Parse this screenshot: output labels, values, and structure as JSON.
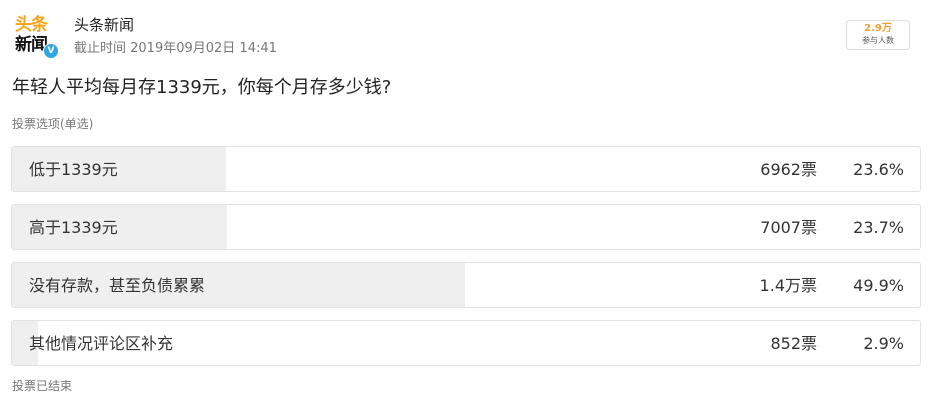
{
  "account": {
    "logo_text_line1": "头条",
    "logo_text_line2": "新闻",
    "verified_mark": "V",
    "name": "头条新闻",
    "publish_time": "截止时间 2019年09月02日 14:41"
  },
  "participants": {
    "count": "2.9万",
    "label": "参与人数"
  },
  "poll": {
    "question": "年轻人平均每月存1339元，你每个月存多少钱?",
    "vote_type": "投票选项(单选)",
    "status": "投票已结束",
    "options": [
      {
        "label": "低于1339元",
        "votes": "6962票",
        "percent": "23.6%",
        "share": 0.236
      },
      {
        "label": "高于1339元",
        "votes": "7007票",
        "percent": "23.7%",
        "share": 0.237
      },
      {
        "label": "没有存款，甚至负债累累",
        "votes": "1.4万票",
        "percent": "49.9%",
        "share": 0.499
      },
      {
        "label": "其他情况评论区补充",
        "votes": "852票",
        "percent": "2.9%",
        "share": 0.029
      }
    ]
  },
  "colors": {
    "logo_accent": "#f5a31a",
    "verified_badge": "#2fa7e6",
    "participants_count": "#f0a030",
    "option_fill": "#efefef"
  },
  "icons": {
    "logo": "toutiao-news-logo",
    "verified": "verified-badge-icon"
  }
}
